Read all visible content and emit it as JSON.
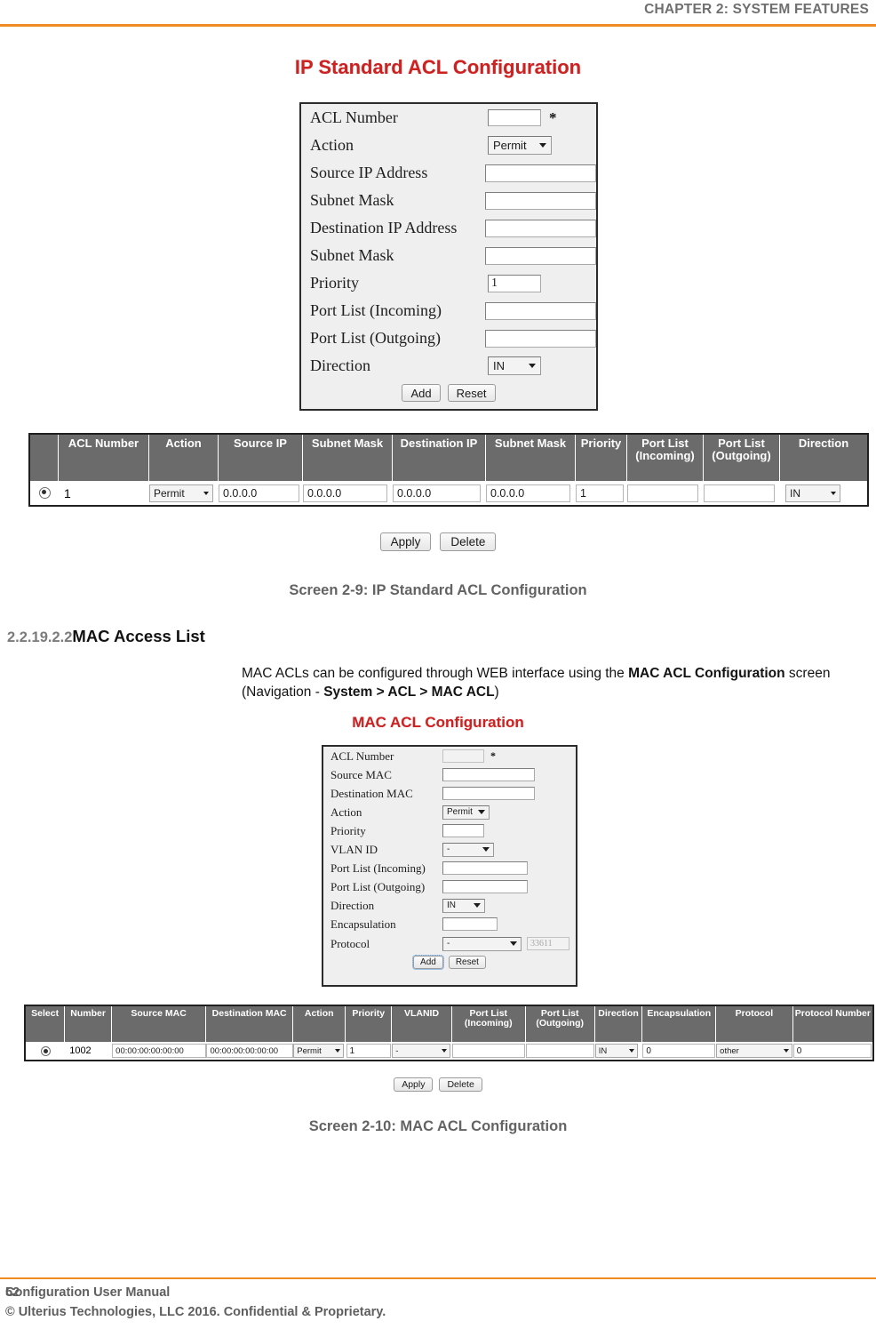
{
  "header": {
    "chapter": "CHAPTER 2: SYSTEM FEATURES",
    "rule_color": "#ef8b22"
  },
  "screen_ip": {
    "title": "IP Standard ACL Configuration",
    "title_color": "#cc2222",
    "form": {
      "required_marker": "*",
      "fields": [
        {
          "label": "ACL Number",
          "type": "text",
          "value": "",
          "required": true
        },
        {
          "label": "Action",
          "type": "select",
          "value": "Permit"
        },
        {
          "label": "Source IP Address",
          "type": "text",
          "value": ""
        },
        {
          "label": "Subnet Mask",
          "type": "text",
          "value": ""
        },
        {
          "label": "Destination IP Address",
          "type": "text",
          "value": ""
        },
        {
          "label": "Subnet Mask",
          "type": "text",
          "value": ""
        },
        {
          "label": "Priority",
          "type": "text",
          "value": "1"
        },
        {
          "label": "Port List (Incoming)",
          "type": "text",
          "value": ""
        },
        {
          "label": "Port List (Outgoing)",
          "type": "text",
          "value": ""
        },
        {
          "label": "Direction",
          "type": "select",
          "value": "IN"
        }
      ],
      "add_label": "Add",
      "reset_label": "Reset"
    },
    "table": {
      "headers": [
        "",
        "ACL Number",
        "Action",
        "Source IP",
        "Subnet Mask",
        "Destination IP",
        "Subnet Mask",
        "Priority",
        "Port List (Incoming)",
        "Port List (Outgoing)",
        "Direction"
      ],
      "rows": [
        {
          "selected": true,
          "acl_number": "1",
          "action": "Permit",
          "source_ip": "0.0.0.0",
          "subnet_mask_1": "0.0.0.0",
          "destination_ip": "0.0.0.0",
          "subnet_mask_2": "0.0.0.0",
          "priority": "1",
          "port_list_in": "",
          "port_list_out": "",
          "direction": "IN"
        }
      ]
    },
    "apply_label": "Apply",
    "delete_label": "Delete",
    "caption": "Screen 2-9: IP Standard ACL Configuration"
  },
  "section": {
    "number": "2.2.19.2.2",
    "title": "MAC Access List",
    "paragraph": {
      "part1": "MAC ACLs can be configured through WEB interface using the ",
      "bold1": "MAC ACL Configuration",
      "part2": " screen (Navigation - ",
      "bold2": "System > ACL > MAC ACL",
      "part3": ")"
    }
  },
  "screen_mac": {
    "title": "MAC ACL Configuration",
    "title_color": "#cc2222",
    "form": {
      "required_marker": "*",
      "fields": [
        {
          "label": "ACL Number",
          "type": "text",
          "value": "",
          "required": true
        },
        {
          "label": "Source MAC",
          "type": "text",
          "value": ""
        },
        {
          "label": "Destination MAC",
          "type": "text",
          "value": ""
        },
        {
          "label": "Action",
          "type": "select",
          "value": "Permit"
        },
        {
          "label": "Priority",
          "type": "text",
          "value": ""
        },
        {
          "label": "VLAN ID",
          "type": "select",
          "value": "-"
        },
        {
          "label": "Port List (Incoming)",
          "type": "text",
          "value": ""
        },
        {
          "label": "Port List (Outgoing)",
          "type": "text",
          "value": ""
        },
        {
          "label": "Direction",
          "type": "select",
          "value": "IN"
        },
        {
          "label": "Encapsulation",
          "type": "text",
          "value": ""
        },
        {
          "label": "Protocol",
          "type": "select",
          "value": "-",
          "extra_value": "33611",
          "extra_disabled": true
        }
      ],
      "add_label": "Add",
      "reset_label": "Reset"
    },
    "table": {
      "headers": [
        "Select",
        "Number",
        "Source MAC",
        "Destination MAC",
        "Action",
        "Priority",
        "VLANID",
        "Port List (Incoming)",
        "Port List (Outgoing)",
        "Direction",
        "Encapsulation",
        "Protocol",
        "Protocol Number"
      ],
      "rows": [
        {
          "selected": true,
          "number": "1002",
          "source_mac": "00:00:00:00:00:00",
          "destination_mac": "00:00:00:00:00:00",
          "action": "Permit",
          "priority": "1",
          "vlan_id": "-",
          "port_list_in": "",
          "port_list_out": "",
          "direction": "IN",
          "encapsulation": "0",
          "protocol": "other",
          "protocol_number": "0"
        }
      ]
    },
    "apply_label": "Apply",
    "delete_label": "Delete",
    "caption": "Screen 2-10: MAC ACL Configuration"
  },
  "footer": {
    "line1": "Configuration User Manual",
    "line2": "© Ulterius Technologies, LLC 2016. Confidential & Proprietary.",
    "page_number": "52"
  }
}
